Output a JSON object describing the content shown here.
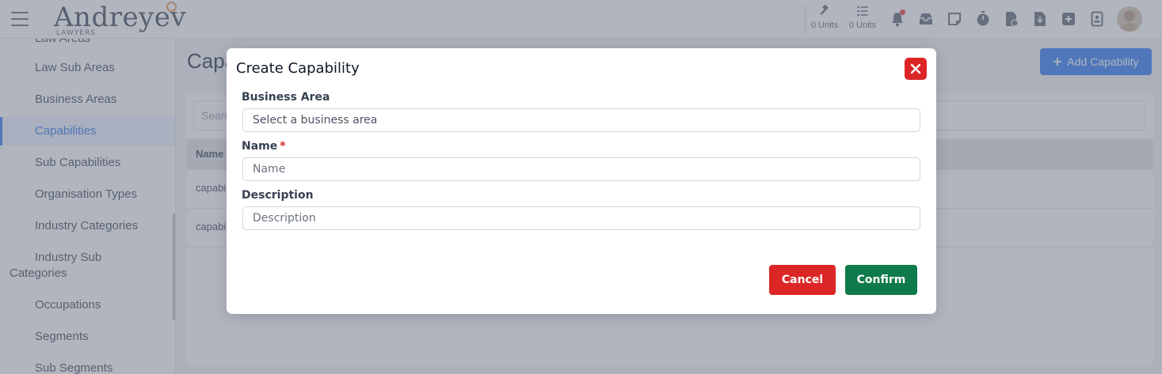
{
  "header": {
    "brand_name": "Andreyev",
    "brand_sub": "LAWYERS",
    "units": [
      {
        "icon": "gavel-icon",
        "label": "0 Units"
      },
      {
        "icon": "list-icon",
        "label": "0 Units"
      }
    ],
    "toolbar_icons": [
      "bell-icon",
      "inbox-icon",
      "note-icon",
      "stopwatch-icon",
      "file-question-icon",
      "file-download-icon",
      "plus-square-icon",
      "id-badge-icon"
    ]
  },
  "sidebar": {
    "items": [
      {
        "label": "Law Areas"
      },
      {
        "label": "Law Sub Areas"
      },
      {
        "label": "Business Areas"
      },
      {
        "label": "Capabilities",
        "active": true
      },
      {
        "label": "Sub Capabilities"
      },
      {
        "label": "Organisation Types"
      },
      {
        "label": "Industry Categories"
      },
      {
        "label": "Industry Sub Categories"
      },
      {
        "label": "Occupations"
      },
      {
        "label": "Segments"
      },
      {
        "label": "Sub Segments"
      }
    ]
  },
  "main": {
    "title": "Capabilities",
    "add_button": "Add Capability",
    "search_placeholder": "Search",
    "table": {
      "columns": [
        "Name"
      ],
      "rows": [
        [
          "capability one"
        ],
        [
          "capability two"
        ]
      ]
    }
  },
  "modal": {
    "title": "Create Capability",
    "fields": [
      {
        "label": "Business Area",
        "required": false,
        "value": "Select a business area"
      },
      {
        "label": "Name",
        "required": true,
        "value": "Name"
      },
      {
        "label": "Description",
        "required": false,
        "value": "Description"
      }
    ],
    "required_marker": "*",
    "cancel_label": "Cancel",
    "confirm_label": "Confirm"
  },
  "colors": {
    "accent": "#3b82f6",
    "danger": "#dc2626",
    "success": "#0f7a4c"
  }
}
